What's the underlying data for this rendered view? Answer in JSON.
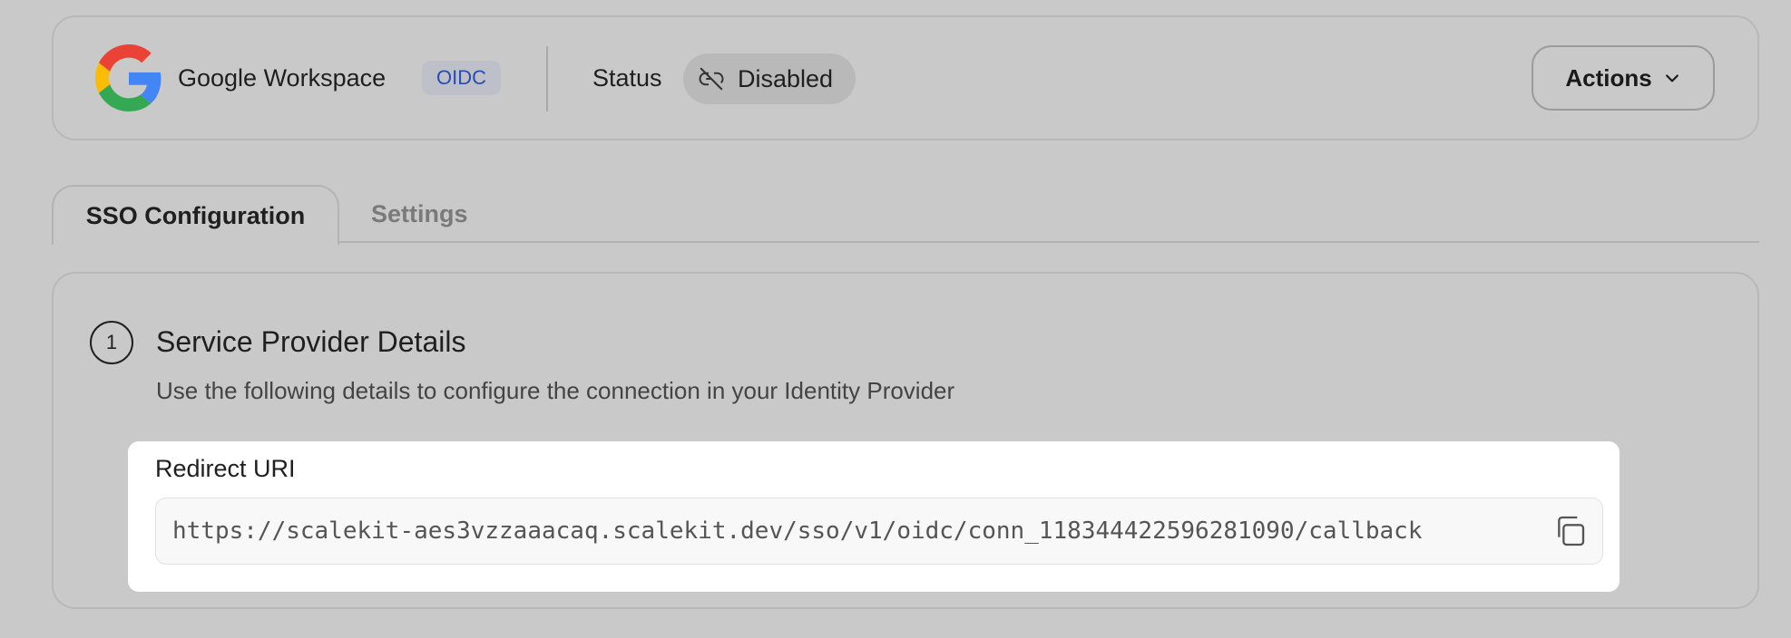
{
  "header": {
    "provider_name": "Google Workspace",
    "protocol_badge": "OIDC",
    "status_label": "Status",
    "status_value": "Disabled",
    "actions_label": "Actions",
    "icons": {
      "logo": "google-logo-icon",
      "status": "link-off-icon",
      "actions": "chevron-down-icon"
    }
  },
  "tabs": [
    {
      "label": "SSO Configuration",
      "active": true
    },
    {
      "label": "Settings",
      "active": false
    }
  ],
  "section": {
    "step_number": "1",
    "title": "Service Provider Details",
    "description": "Use the following details to configure the connection in your Identity Provider"
  },
  "redirect_uri": {
    "label": "Redirect URI",
    "value": "https://scalekit-aes3vzzaaacaq.scalekit.dev/sso/v1/oidc/conn_118344422596281090/callback",
    "copy_icon": "copy-icon"
  },
  "colors": {
    "page_background": "#c9c9c9",
    "badge_text": "#2a4bb0",
    "google_blue": "#4285F4",
    "google_red": "#EA4335",
    "google_yellow": "#FBBC05",
    "google_green": "#34A853"
  }
}
